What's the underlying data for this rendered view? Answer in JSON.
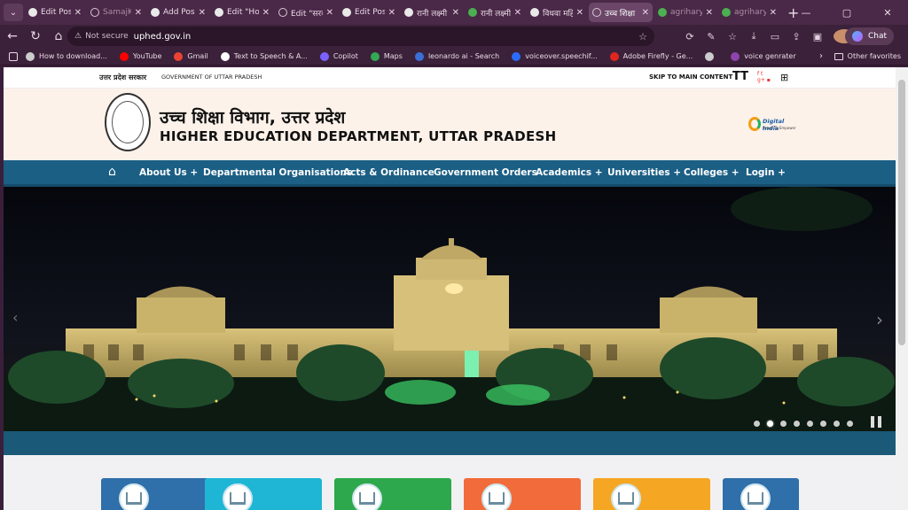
{
  "browser": {
    "tabs": [
      {
        "title": "Edit Post",
        "favicon": "wordpress-icon",
        "state": "normal"
      },
      {
        "title": "SamajKal",
        "favicon": "globe-icon",
        "state": "dim"
      },
      {
        "title": "Add Post",
        "favicon": "wordpress-icon",
        "state": "normal"
      },
      {
        "title": "Edit \"Hon",
        "favicon": "wordpress-icon",
        "state": "normal"
      },
      {
        "title": "Edit \"सरक",
        "favicon": "globe-icon",
        "state": "normal"
      },
      {
        "title": "Edit Post",
        "favicon": "wordpress-icon",
        "state": "normal"
      },
      {
        "title": "रानी लक्ष्मी",
        "favicon": "wordpress-icon",
        "state": "normal"
      },
      {
        "title": "रानी लक्ष्मी",
        "favicon": "green-icon",
        "state": "normal"
      },
      {
        "title": "विधवा महि",
        "favicon": "wordpress-icon",
        "state": "normal"
      },
      {
        "title": "उच्च शिक्षा",
        "favicon": "globe-icon",
        "state": "active"
      },
      {
        "title": "agrihary",
        "favicon": "green-icon",
        "state": "dim"
      },
      {
        "title": "agrihary",
        "favicon": "green-icon",
        "state": "dim"
      }
    ],
    "address": {
      "security_label": "Not secure",
      "url": "uphed.gov.in"
    },
    "chat_label": "Chat",
    "bookmarks": [
      {
        "label": "How to download...",
        "icon_color": "#cccccc"
      },
      {
        "label": "YouTube",
        "icon_color": "#ff0000"
      },
      {
        "label": "Gmail",
        "icon_color": "#ea4335"
      },
      {
        "label": "Text to Speech & A...",
        "icon_color": "#ffffff"
      },
      {
        "label": "Copilot",
        "icon_color": "#7b61ff"
      },
      {
        "label": "Maps",
        "icon_color": "#34a853"
      },
      {
        "label": "leonardo ai - Search",
        "icon_color": "#3a6fd8"
      },
      {
        "label": "voiceover.speechif...",
        "icon_color": "#2b6cff"
      },
      {
        "label": "Adobe Firefly - Ge...",
        "icon_color": "#e0261f"
      },
      {
        "label": "",
        "icon_color": "#cccccc"
      },
      {
        "label": "voice genrater",
        "icon_color": "#8e44ad"
      }
    ],
    "other_favorites": "Other favorites"
  },
  "site": {
    "top_strip": {
      "govt_hindi": "उत्तर प्रदेश सरकार",
      "govt_english": "GOVERNMENT OF UTTAR PRADESH",
      "skip_label": "SKIP TO MAIN CONTENT",
      "text_size_label": "TT"
    },
    "header": {
      "title_hindi": "उच्च शिक्षा विभाग, उत्तर प्रदेश",
      "title_english": "HIGHER EDUCATION DEPARTMENT, UTTAR PRADESH",
      "digital_india": "Digital India",
      "digital_india_tag": "Power To Empower"
    },
    "nav": [
      {
        "label": "About Us +"
      },
      {
        "label": "Departmental Organisations"
      },
      {
        "label": "Acts & Ordinance"
      },
      {
        "label": "Government Orders"
      },
      {
        "label": "Academics +"
      },
      {
        "label": "Universities +"
      },
      {
        "label": "Colleges +"
      },
      {
        "label": "Login +"
      }
    ],
    "slider": {
      "slide_count": 8,
      "active_slide": 2
    },
    "cards": [
      {
        "color": "#2f6faa"
      },
      {
        "color": "#1fb6d6"
      },
      {
        "color": "#2ea84c"
      },
      {
        "color": "#f26b3a"
      },
      {
        "color": "#f5a623"
      },
      {
        "color": "#2f6faa"
      }
    ]
  }
}
